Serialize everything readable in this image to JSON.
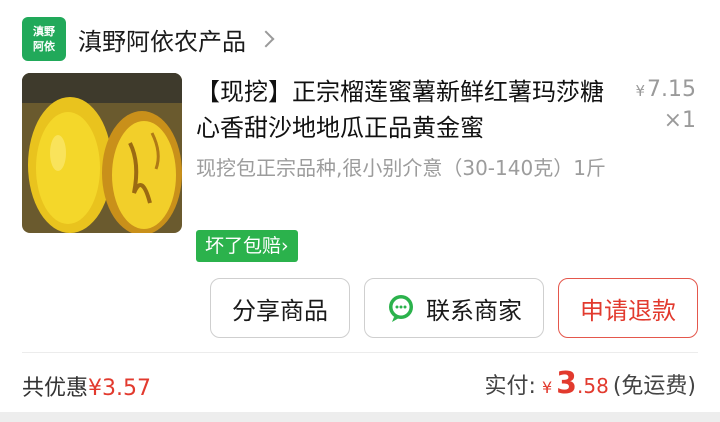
{
  "shop": {
    "logo_line1": "滇野",
    "logo_line2": "阿依",
    "name": "滇野阿依农产品"
  },
  "product": {
    "title": "【现挖】正宗榴莲蜜薯新鲜红薯玛莎糖心香甜沙地地瓜正品黄金蜜",
    "price_symbol": "¥",
    "price": "7.15",
    "quantity": "×1",
    "spec": "现挖包正宗品种,很小别介意（30-140克）1斤",
    "guarantee_badge": "坏了包赔",
    "guarantee_arrow": "›"
  },
  "actions": {
    "share_label": "分享商品",
    "contact_label": "联系商家",
    "refund_label": "申请退款"
  },
  "summary": {
    "discount_label": "共优惠",
    "discount_amount": "¥3.57",
    "paid_label": "实付:",
    "paid_symbol": "¥",
    "paid_int": "3",
    "paid_dec": ".58",
    "shipping_note": "(免运费)"
  },
  "colors": {
    "brand_green": "#2bb24c",
    "accent_red": "#e23a2e"
  }
}
